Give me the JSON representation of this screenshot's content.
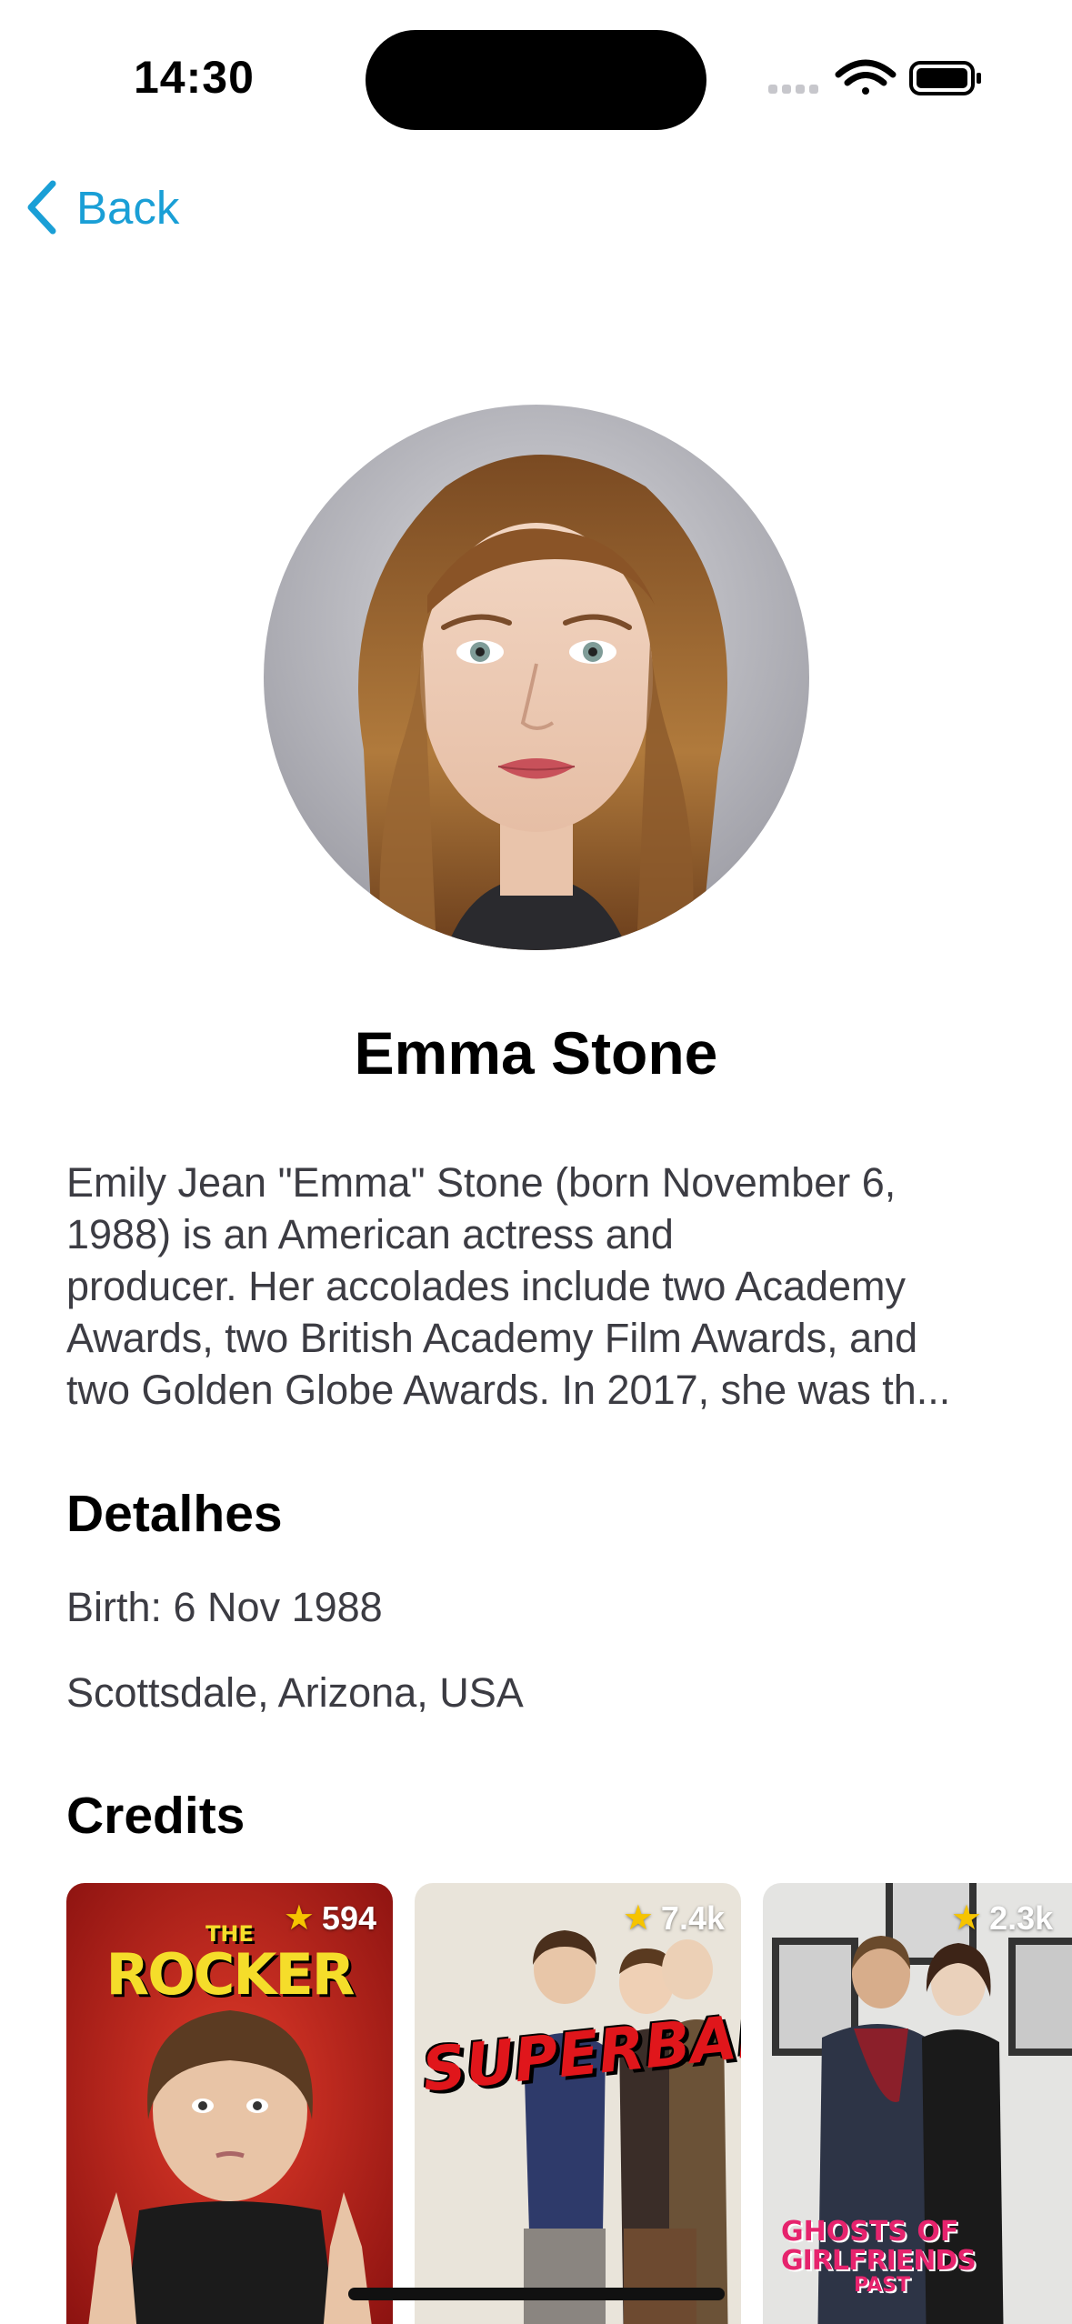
{
  "status_bar": {
    "time": "14:30",
    "icons": [
      "cellular-dots-icon",
      "wifi-icon",
      "battery-icon"
    ]
  },
  "nav": {
    "back_label": "Back",
    "back_icon": "chevron-left-icon"
  },
  "person": {
    "name": "Emma Stone",
    "bio_lines": [
      "Emily Jean \"Emma\" Stone (born November 6,",
      "1988) is an American actress and",
      "producer. Her accolades include two Academy",
      "Awards, two British Academy Film Awards, and",
      "two Golden Globe Awards. In 2017, she was th..."
    ]
  },
  "details": {
    "title": "Detalhes",
    "birth": "Birth: 6 Nov 1988",
    "place": "Scottsdale, Arizona, USA"
  },
  "credits": {
    "title": "Credits",
    "items": [
      {
        "poster_title": [
          "THE",
          "ROCKER"
        ],
        "rating": "594"
      },
      {
        "poster_title": [
          "SUPERBAD"
        ],
        "rating": "7.4k"
      },
      {
        "poster_title": [
          "GHOSTS OF",
          "GIRLFRIENDS",
          "PAST"
        ],
        "rating": "2.3k"
      }
    ]
  },
  "colors": {
    "accent": "#1a9fd6",
    "text_primary": "#000000",
    "text_secondary": "#3c3c43",
    "star": "#f6c400"
  }
}
